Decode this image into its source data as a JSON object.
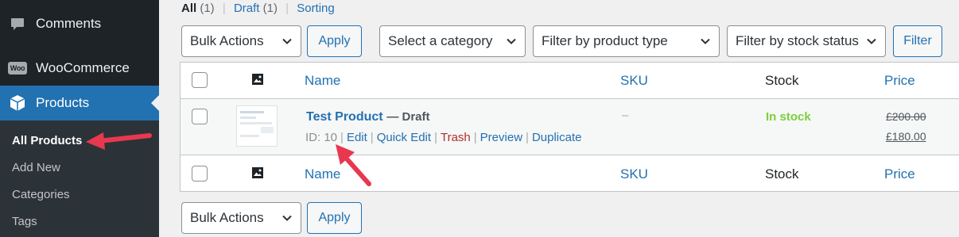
{
  "sidebar": {
    "comments": "Comments",
    "woocommerce": "WooCommerce",
    "woo_badge": "Woo",
    "products": "Products",
    "submenu": [
      "All Products",
      "Add New",
      "Categories",
      "Tags"
    ]
  },
  "views": {
    "all": "All",
    "all_count": "(1)",
    "draft": "Draft",
    "draft_count": "(1)",
    "sorting": "Sorting",
    "sep": "|"
  },
  "filters": {
    "bulk_actions": "Bulk Actions",
    "apply": "Apply",
    "category": "Select a category",
    "product_type": "Filter by product type",
    "stock_status": "Filter by stock status",
    "filter": "Filter"
  },
  "columns": {
    "name": "Name",
    "sku": "SKU",
    "stock": "Stock",
    "price": "Price"
  },
  "product": {
    "title": "Test Product",
    "state": "— Draft",
    "sku": "–",
    "stock": "In stock",
    "regular_price": "£200.00",
    "sale_price": "£180.00",
    "row_actions": {
      "id": "ID: 10",
      "edit": "Edit",
      "quick_edit": "Quick Edit",
      "trash": "Trash",
      "preview": "Preview",
      "duplicate": "Duplicate"
    }
  },
  "colors": {
    "accent": "#2271b1",
    "sidebar_bg": "#1d2327",
    "in_stock": "#7ad03a",
    "trash": "#b32d2e",
    "annotation_arrow": "#e8384f"
  },
  "icons": {
    "comments": "speech-bubble-icon",
    "woocommerce": "woo-badge-icon",
    "products": "box-icon",
    "image_column": "image-icon",
    "select": "chevron-down-icon"
  }
}
